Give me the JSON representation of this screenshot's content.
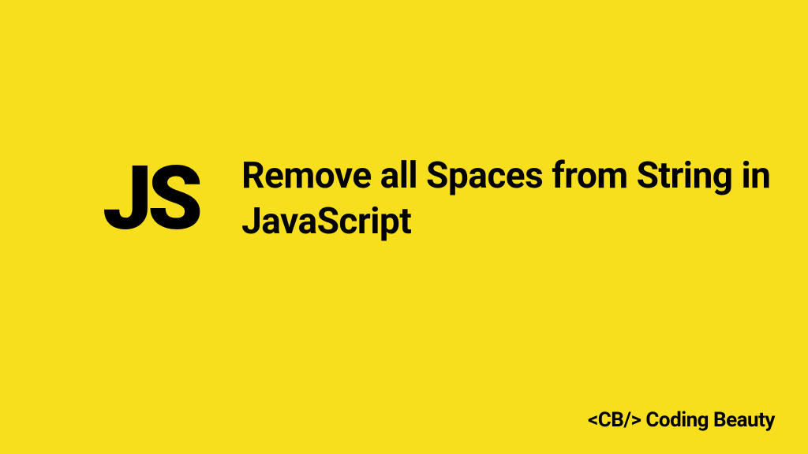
{
  "logo": {
    "text": "JS"
  },
  "content": {
    "title": "Remove all Spaces from String in JavaScript"
  },
  "brand": {
    "full": "<CB/> Coding Beauty"
  },
  "colors": {
    "background": "#f7df1e",
    "text": "#000000"
  }
}
